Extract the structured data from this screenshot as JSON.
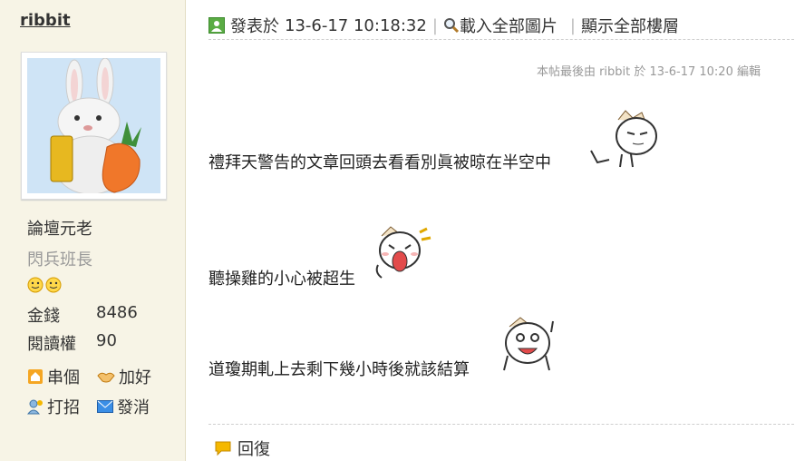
{
  "author": {
    "username": "ribbit",
    "rank": "論壇元老",
    "title": "閃兵班長",
    "stats": [
      {
        "label": "金錢",
        "value": "8486"
      },
      {
        "label": "閱讀權",
        "value": "90"
      }
    ],
    "actions": {
      "visit_label": "串個",
      "add_friend_label": "加好",
      "greet_label": "打招",
      "message_label": "發消"
    }
  },
  "post": {
    "published_prefix": "發表於",
    "timestamp": "13-6-17 10:18:32",
    "load_images_label": "載入全部圖片",
    "show_all_floors_label": "顯示全部樓層",
    "edit_note": "本帖最後由 ribbit 於 13-6-17 10:20 編輯",
    "lines": [
      "禮拜天警告的文章回頭去看看別眞被晾在半空中",
      "聽操雞的小心被超生",
      "道瓊期軋上去剩下幾小時後就該結算"
    ]
  },
  "footer": {
    "reply_label": "回復"
  },
  "colors": {
    "sidebar_bg": "#f7f4e6",
    "avatar_bg": "#cfe4f6",
    "post_icon": "#5aac44",
    "reply_icon": "#f5b800"
  }
}
